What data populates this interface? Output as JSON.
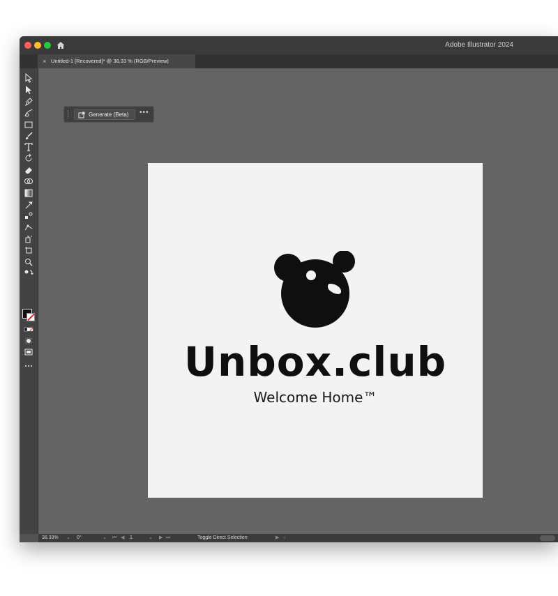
{
  "window": {
    "app_title": "Adobe Illustrator 2024"
  },
  "tab": {
    "close_glyph": "×",
    "title": "Untitled-1 [Recovered]* @ 38.33 % (RGB/Preview)"
  },
  "context_bar": {
    "generate_label": "Generate (Beta)",
    "more_label": "•••"
  },
  "tools": [
    "selection-tool-icon",
    "direct-selection-tool-icon",
    "pen-tool-icon",
    "curvature-tool-icon",
    "rectangle-tool-icon",
    "paintbrush-tool-icon",
    "type-tool-icon",
    "rotate-tool-icon",
    "eraser-tool-icon",
    "shape-builder-tool-icon",
    "gradient-tool-icon",
    "eyedropper-tool-icon",
    "blend-tool-icon",
    "puppet-warp-tool-icon",
    "symbol-sprayer-tool-icon",
    "artboard-tool-icon",
    "zoom-tool-icon",
    "swap-fill-stroke-icon",
    "fill-stroke-swatch-icon",
    "color-mode-icon",
    "draw-mode-icon",
    "screen-mode-icon",
    "more-tools-icon"
  ],
  "artwork": {
    "brand_name": "Unbox.club",
    "tagline": "Welcome Home™",
    "logo_color": "#0f0f0f",
    "background_color": "#f3f3f3"
  },
  "status_bar": {
    "zoom": "38.33%",
    "rotation": "0°",
    "artboard_number": "1",
    "current_tool": "Toggle Direct Selection",
    "nav_first": "⏮",
    "nav_prev": "◀",
    "nav_next": "▶",
    "nav_last": "⏭",
    "menu_arrow": "▶",
    "menu_back": "‹"
  },
  "colors": {
    "workspace": "#646464",
    "toolbar": "#434343",
    "titlebar": "#3a3a3a"
  }
}
